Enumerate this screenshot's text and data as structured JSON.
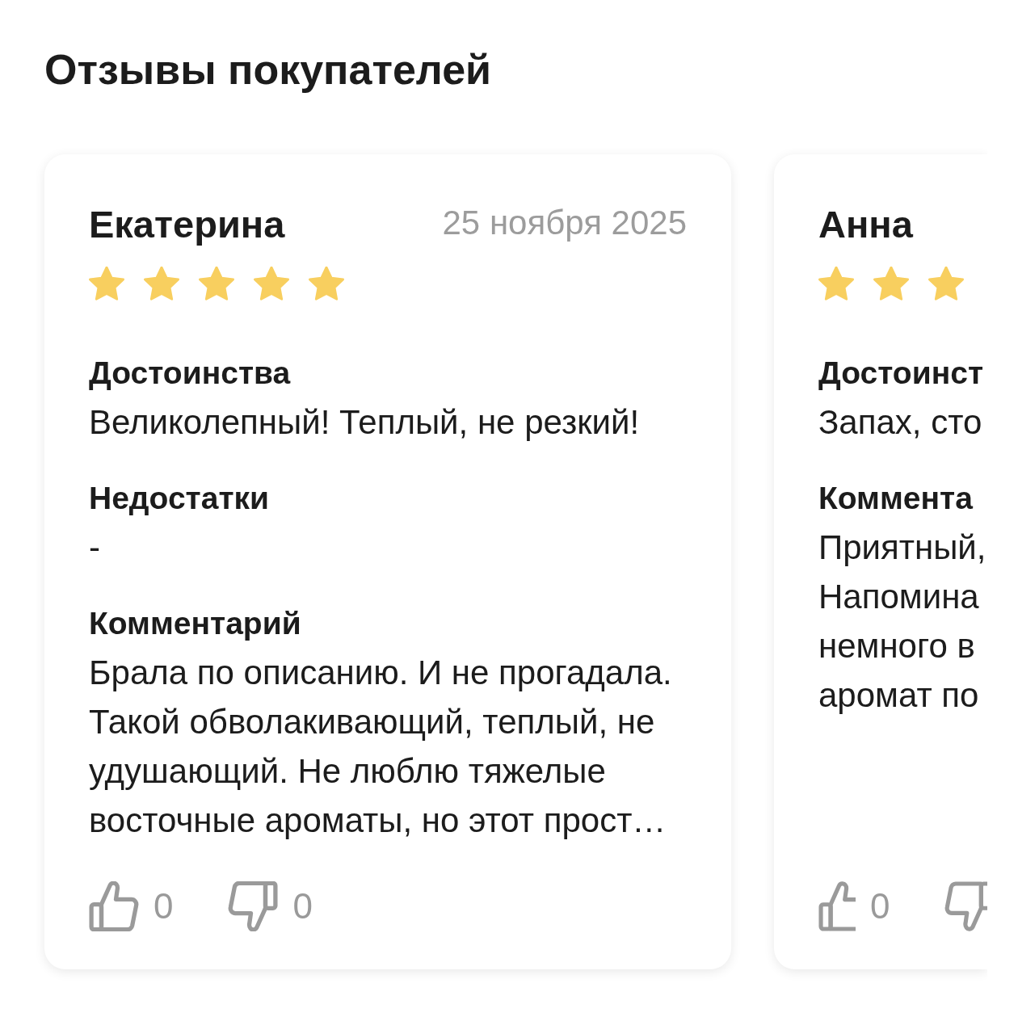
{
  "title": "Отзывы покупателей",
  "reviews": [
    {
      "author": "Екатерина",
      "date": "25 ноября 2025",
      "stars": 5,
      "sections": [
        {
          "label": "Достоинства",
          "lines": [
            "Великолепный! Теплый, не резкий!"
          ]
        },
        {
          "label": "Недостатки",
          "lines": [
            "-"
          ]
        },
        {
          "label": "Комментарий",
          "lines": [
            "Брала по описанию. И не прогадала.",
            "Такой обволакивающий, теплый, не",
            "удушающий. Не люблю тяжелые",
            "восточные ароматы, но этот прост…"
          ]
        }
      ],
      "votes": [
        {
          "kind": "like",
          "count": "0"
        },
        {
          "kind": "dislike",
          "count": "0"
        }
      ]
    },
    {
      "author": "Анна",
      "stars": 3,
      "sections": [
        {
          "label": "Достоинст",
          "lines": [
            "Запах, сто"
          ]
        },
        {
          "label": "Коммента",
          "lines": [
            "Приятный,",
            "Напомина",
            "немного в",
            "аромат по"
          ]
        }
      ],
      "votes": [
        {
          "kind": "like",
          "count": "0"
        },
        {
          "kind": "dislike"
        }
      ]
    }
  ]
}
